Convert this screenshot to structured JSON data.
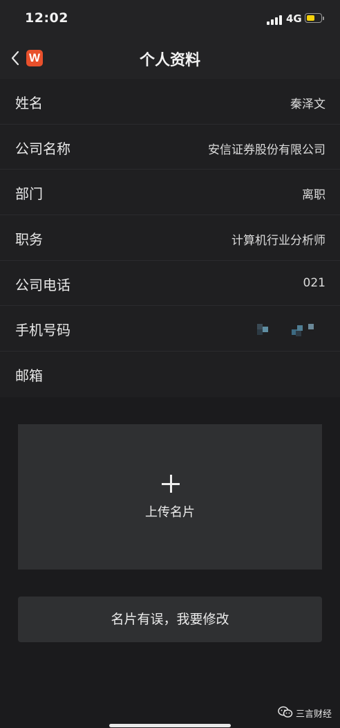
{
  "status_bar": {
    "time": "12:02",
    "network": "4G",
    "battery_level": 0.6,
    "battery_color": "#f5d20b"
  },
  "nav": {
    "back_icon": "chevron-left-icon",
    "app_logo_letter": "W",
    "app_logo_color": "#e8502c",
    "title": "个人资料"
  },
  "profile": {
    "rows": [
      {
        "label": "姓名",
        "value": "秦泽文"
      },
      {
        "label": "公司名称",
        "value": "安信证券股份有限公司"
      },
      {
        "label": "部门",
        "value": "离职"
      },
      {
        "label": "职务",
        "value": "计算机行业分析师"
      },
      {
        "label": "公司电话",
        "value": "021"
      },
      {
        "label": "手机号码",
        "value": ""
      },
      {
        "label": "邮箱",
        "value": ""
      }
    ]
  },
  "upload": {
    "icon": "plus-icon",
    "label": "上传名片"
  },
  "edit_button": {
    "label": "名片有误，我要修改"
  },
  "watermark": {
    "icon": "wechat-icon",
    "text": "三言财经"
  }
}
